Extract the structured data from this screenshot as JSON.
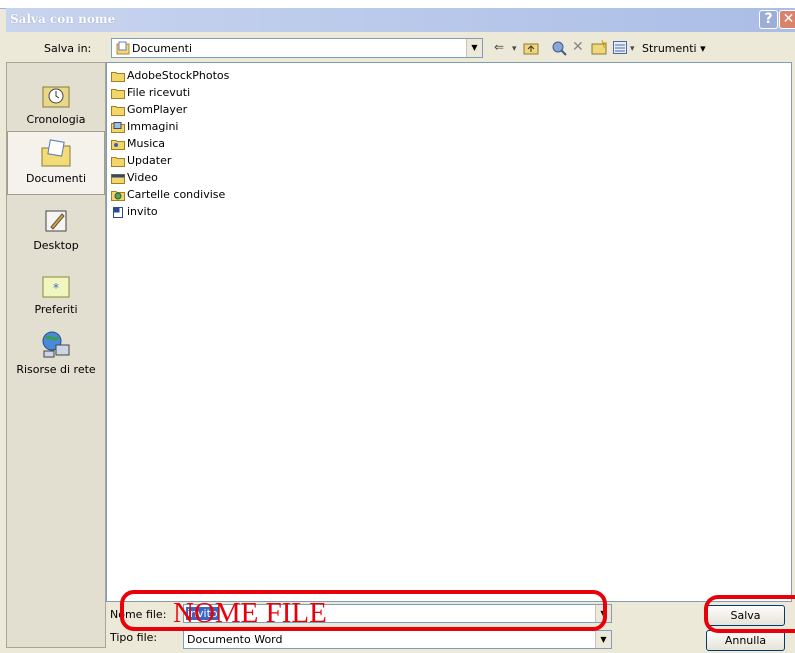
{
  "window": {
    "title": "Salva con nome",
    "help_label": "?",
    "close_label": "✕"
  },
  "save_in": {
    "label": "Salva in:",
    "value": "Documenti",
    "icon": "folder-documents-icon"
  },
  "toolbar": {
    "back": "⇐",
    "up": "↥",
    "search": "search-web-icon",
    "delete": "✕",
    "new_folder": "new-folder-icon",
    "views": "views-icon",
    "tools_label": "Strumenti ▾"
  },
  "places": [
    {
      "label": "Cronologia",
      "icon": "history-icon"
    },
    {
      "label": "Documenti",
      "icon": "documents-folder-icon",
      "selected": true
    },
    {
      "label": "Desktop",
      "icon": "desktop-icon"
    },
    {
      "label": "Preferiti",
      "icon": "favorites-folder-icon"
    },
    {
      "label": "Risorse di rete",
      "icon": "network-icon"
    }
  ],
  "files": [
    {
      "name": "AdobeStockPhotos",
      "icon": "folder-icon"
    },
    {
      "name": "File ricevuti",
      "icon": "folder-icon"
    },
    {
      "name": "GomPlayer",
      "icon": "folder-icon"
    },
    {
      "name": "Immagini",
      "icon": "pictures-folder-icon"
    },
    {
      "name": "Musica",
      "icon": "music-folder-icon"
    },
    {
      "name": "Updater",
      "icon": "folder-icon"
    },
    {
      "name": "Video",
      "icon": "video-folder-icon"
    },
    {
      "name": "Cartelle condivise",
      "icon": "shared-folder-icon"
    },
    {
      "name": "invito",
      "icon": "word-document-icon"
    }
  ],
  "filename": {
    "label": "Nome file:",
    "value": "invito"
  },
  "filetype": {
    "label": "Tipo file:",
    "value": "Documento Word"
  },
  "buttons": {
    "save": "Salva",
    "cancel": "Annulla"
  },
  "annotation": {
    "text": "NOME FILE",
    "color": "#e8000b"
  }
}
